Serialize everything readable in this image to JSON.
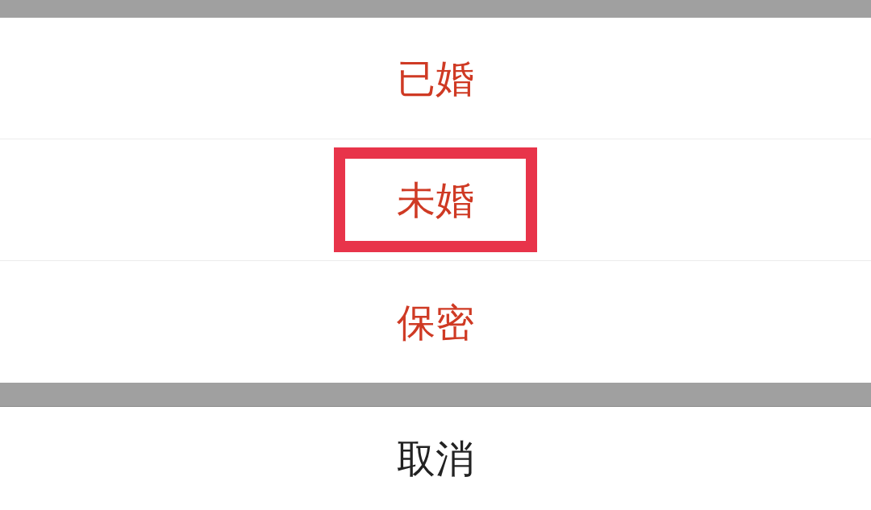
{
  "options": [
    {
      "label": "已婚",
      "highlighted": false
    },
    {
      "label": "未婚",
      "highlighted": true
    },
    {
      "label": "保密",
      "highlighted": false
    }
  ],
  "cancel": {
    "label": "取消"
  }
}
